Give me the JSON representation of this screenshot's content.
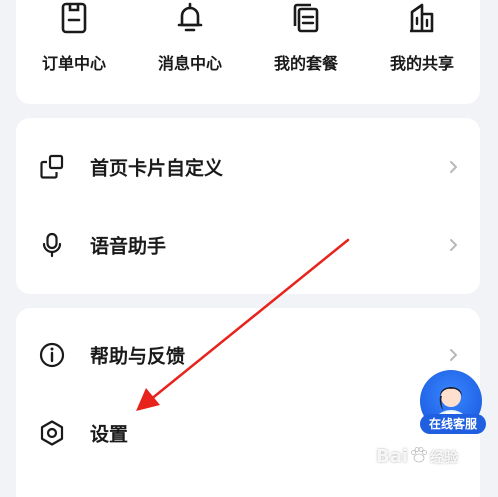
{
  "quick_actions": [
    {
      "label": "订单中心",
      "icon": "order-icon"
    },
    {
      "label": "消息中心",
      "icon": "bell-icon"
    },
    {
      "label": "我的套餐",
      "icon": "package-icon"
    },
    {
      "label": "我的共享",
      "icon": "share-icon"
    }
  ],
  "menu_group_1": [
    {
      "label": "首页卡片自定义",
      "icon": "cards-icon"
    },
    {
      "label": "语音助手",
      "icon": "microphone-icon"
    }
  ],
  "menu_group_2": [
    {
      "label": "帮助与反馈",
      "icon": "info-icon"
    },
    {
      "label": "设置",
      "icon": "settings-icon"
    }
  ],
  "floating_service": {
    "label": "在线客服"
  },
  "watermark": {
    "text_1": "Bai",
    "text_2": "经验"
  },
  "colors": {
    "background": "#f2f3f7",
    "card": "#ffffff",
    "text": "#1a1a1a",
    "chevron": "#b8b8bd",
    "annotation_arrow": "#e8231c",
    "service_badge": "#1f5fe0"
  }
}
